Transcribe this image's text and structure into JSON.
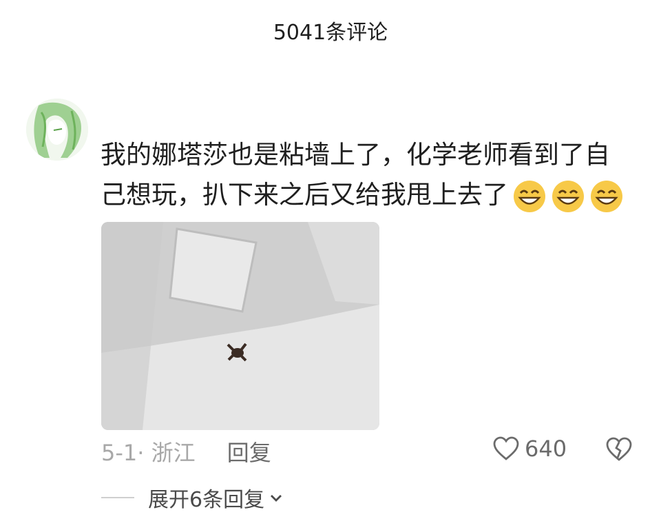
{
  "header": {
    "title": "5041条评论"
  },
  "comment": {
    "text": "我的娜塔莎也是粘墙上了，化学老师看到了自己想玩，扒下来之后又给我甩上去了",
    "emojis": [
      "grin-emoji",
      "grin-emoji",
      "grin-emoji"
    ],
    "date_location": "5-1· 浙江",
    "reply_label": "回复",
    "like_count": "640"
  },
  "replies": {
    "expand_label": "展开6条回复"
  },
  "colors": {
    "text": "#1f1f1f",
    "muted": "#a8a8a8",
    "secondary": "#6b6b6b",
    "emoji": "#f7c948"
  }
}
